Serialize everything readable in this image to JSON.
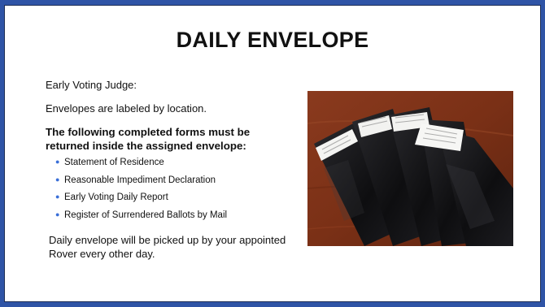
{
  "slide": {
    "title": "DAILY ENVELOPE",
    "judge_line": "Early Voting Judge:",
    "labeled_line": "Envelopes are labeled by location.",
    "forms_heading": "The following completed forms must be returned inside the assigned envelope:",
    "forms": [
      "Statement of Residence",
      "Reasonable Impediment Declaration",
      "Early Voting Daily Report",
      "Register of Surrendered Ballots by Mail"
    ],
    "pickup_note": "Daily envelope will be picked up by your appointed Rover every other day."
  },
  "colors": {
    "frame_blue": "#2f54a6",
    "bullet_blue": "#3a6fd8"
  },
  "icons": {
    "bullet": "bullet-dot"
  }
}
